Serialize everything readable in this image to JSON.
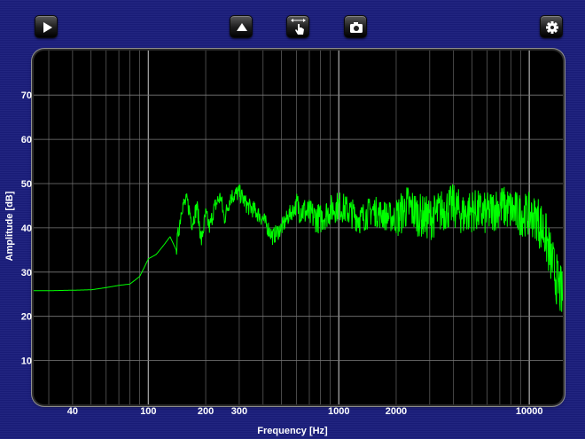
{
  "toolbar": {
    "buttons": [
      {
        "name": "play-button",
        "icon": "play-icon"
      },
      {
        "name": "eject-button",
        "icon": "eject-icon"
      },
      {
        "name": "pan-zoom-button",
        "icon": "hand-pointer-icon"
      },
      {
        "name": "camera-button",
        "icon": "camera-icon"
      },
      {
        "name": "settings-button",
        "icon": "gear-icon"
      }
    ]
  },
  "colors": {
    "background": "#1a1d7c",
    "plot_background": "#000000",
    "grid": "#7a7a7a",
    "trace": "#00ff00",
    "text": "#ffffff"
  },
  "chart_data": {
    "type": "line",
    "title": "",
    "xlabel": "Frequency [Hz]",
    "ylabel": "Amplitude [dB]",
    "xscale": "log",
    "xlim": [
      25,
      15000
    ],
    "ylim": [
      0,
      77
    ],
    "xticks": [
      40,
      100,
      200,
      300,
      1000,
      2000,
      10000
    ],
    "xtick_labels": [
      "40",
      "100",
      "200",
      "300",
      "1000",
      "2000",
      "10000"
    ],
    "yticks": [
      10,
      20,
      30,
      40,
      50,
      60,
      70
    ],
    "ytick_labels": [
      "10",
      "20",
      "30",
      "40",
      "50",
      "60",
      "70"
    ],
    "grid": true,
    "series": [
      {
        "color": "#00ff00",
        "x": [
          25,
          30,
          40,
          50,
          60,
          70,
          80,
          90,
          95,
          100,
          110,
          120,
          130,
          140,
          150,
          160,
          170,
          180,
          190,
          200,
          210,
          220,
          230,
          240,
          250,
          270,
          300,
          330,
          360,
          400,
          450,
          500,
          550,
          600,
          700,
          800,
          900,
          1000,
          1100,
          1200,
          1300,
          1500,
          1700,
          2000,
          2300,
          2600,
          3000,
          3500,
          4000,
          4500,
          5000,
          6000,
          7000,
          8000,
          9000,
          10000,
          11000,
          12000,
          13000,
          14000,
          15000
        ],
        "y": [
          25.8,
          25.8,
          25.9,
          26,
          26.5,
          27,
          27.3,
          29,
          31,
          33,
          34,
          36,
          38,
          35,
          45,
          46,
          41,
          45,
          37,
          43,
          40,
          44,
          46,
          47,
          42,
          47,
          48,
          45,
          44,
          42,
          38,
          40,
          43,
          45,
          43,
          42,
          44,
          45,
          44,
          43,
          42,
          44,
          43,
          42,
          45,
          43,
          42,
          44,
          45,
          43,
          44,
          43,
          45,
          44,
          43,
          43,
          42,
          39,
          33,
          28,
          24
        ]
      }
    ]
  }
}
